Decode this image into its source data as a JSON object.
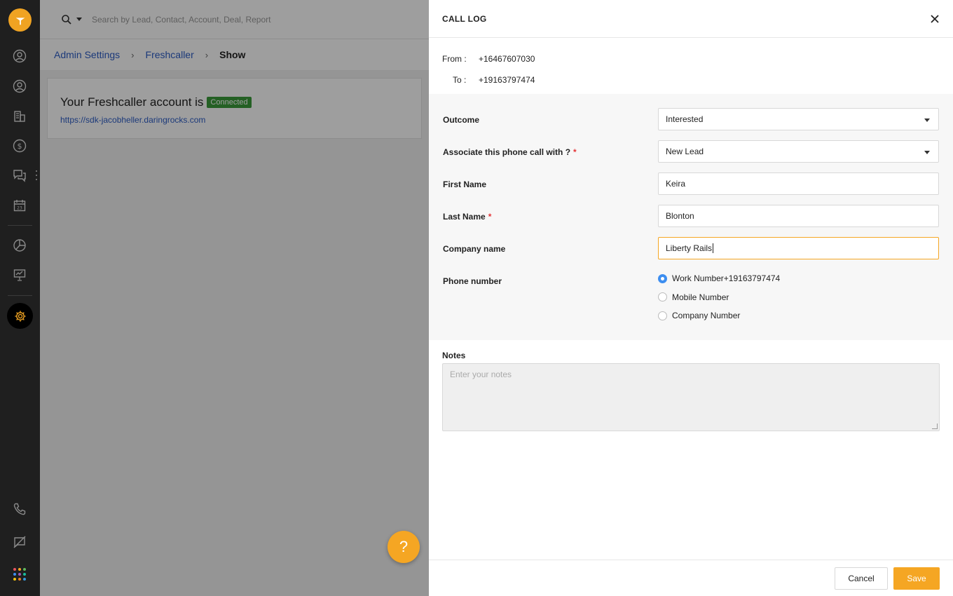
{
  "search": {
    "placeholder": "Search by Lead, Contact, Account, Deal, Report"
  },
  "breadcrumb": {
    "level1": "Admin Settings",
    "level2": "Freshcaller",
    "current": "Show"
  },
  "account": {
    "title": "Your Freshcaller account is",
    "status": "Connected",
    "url": "https://sdk-jacobheller.daringrocks.com"
  },
  "drawer": {
    "title": "CALL LOG",
    "from_label": "From :",
    "from_value": "+16467607030",
    "to_label": "To :",
    "to_value": "+19163797474",
    "fields": {
      "outcome_label": "Outcome",
      "outcome_value": "Interested",
      "associate_label": "Associate this phone call with ?",
      "associate_value": "New Lead",
      "first_name_label": "First Name",
      "first_name_value": "Keira",
      "last_name_label": "Last Name",
      "last_name_value": "Blonton",
      "company_label": "Company name",
      "company_value": "Liberty Rails",
      "phone_label": "Phone number",
      "phone_options": [
        "Work Number+19163797474",
        "Mobile Number",
        "Company Number"
      ],
      "phone_selected": "Work Number+19163797474"
    },
    "notes_label": "Notes",
    "notes_placeholder": "Enter your notes",
    "cancel_label": "Cancel",
    "save_label": "Save",
    "required_mark": "*"
  },
  "help_label": "?",
  "colors": {
    "accent": "#f5a623",
    "link": "#2c5cc5",
    "connected": "#3a9b3a",
    "radio_selected": "#3d8ef0",
    "required": "#e43538"
  }
}
